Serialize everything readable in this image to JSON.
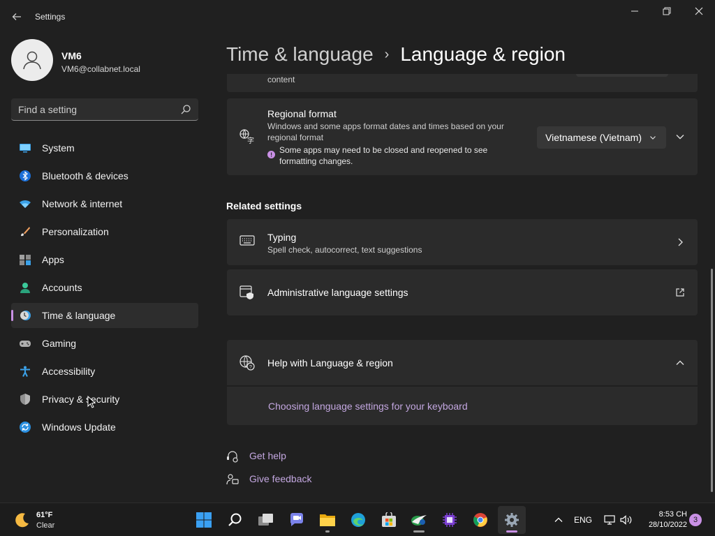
{
  "window": {
    "title": "Settings",
    "minimize": "—",
    "maximize": "❐",
    "close": "✕"
  },
  "profile": {
    "name": "VM6",
    "email": "VM6@collabnet.local"
  },
  "search": {
    "placeholder": "Find a setting"
  },
  "sidebar": {
    "items": [
      {
        "label": "System",
        "icon": "monitor-icon"
      },
      {
        "label": "Bluetooth & devices",
        "icon": "bluetooth-icon"
      },
      {
        "label": "Network & internet",
        "icon": "wifi-icon"
      },
      {
        "label": "Personalization",
        "icon": "brush-icon"
      },
      {
        "label": "Apps",
        "icon": "apps-icon"
      },
      {
        "label": "Accounts",
        "icon": "person-icon"
      },
      {
        "label": "Time & language",
        "icon": "clock-globe-icon",
        "active": true
      },
      {
        "label": "Gaming",
        "icon": "gamepad-icon"
      },
      {
        "label": "Accessibility",
        "icon": "accessibility-icon"
      },
      {
        "label": "Privacy & security",
        "icon": "shield-icon"
      },
      {
        "label": "Windows Update",
        "icon": "update-icon"
      }
    ]
  },
  "breadcrumb": {
    "parent": "Time & language",
    "separator": "›",
    "current": "Language & region"
  },
  "content": {
    "partial_card_text": "content",
    "regional_format": {
      "title": "Regional format",
      "description": "Windows and some apps format dates and times based on your regional format",
      "warning": "Some apps may need to be closed and reopened to see formatting changes.",
      "selected": "Vietnamese (Vietnam)"
    },
    "related_settings_heading": "Related settings",
    "typing": {
      "title": "Typing",
      "description": "Spell check, autocorrect, text suggestions"
    },
    "admin_language": {
      "title": "Administrative language settings"
    },
    "help": {
      "title": "Help with Language & region",
      "link": "Choosing language settings for your keyboard"
    },
    "get_help": "Get help",
    "give_feedback": "Give feedback"
  },
  "taskbar": {
    "weather": {
      "temp": "61°F",
      "condition": "Clear"
    },
    "tray": {
      "language": "ENG"
    },
    "clock": {
      "time": "8:53 CH",
      "date": "28/10/2022"
    },
    "notifications": "3"
  },
  "colors": {
    "accent": "#c990e5",
    "background": "#202020",
    "card": "#2b2b2b"
  }
}
